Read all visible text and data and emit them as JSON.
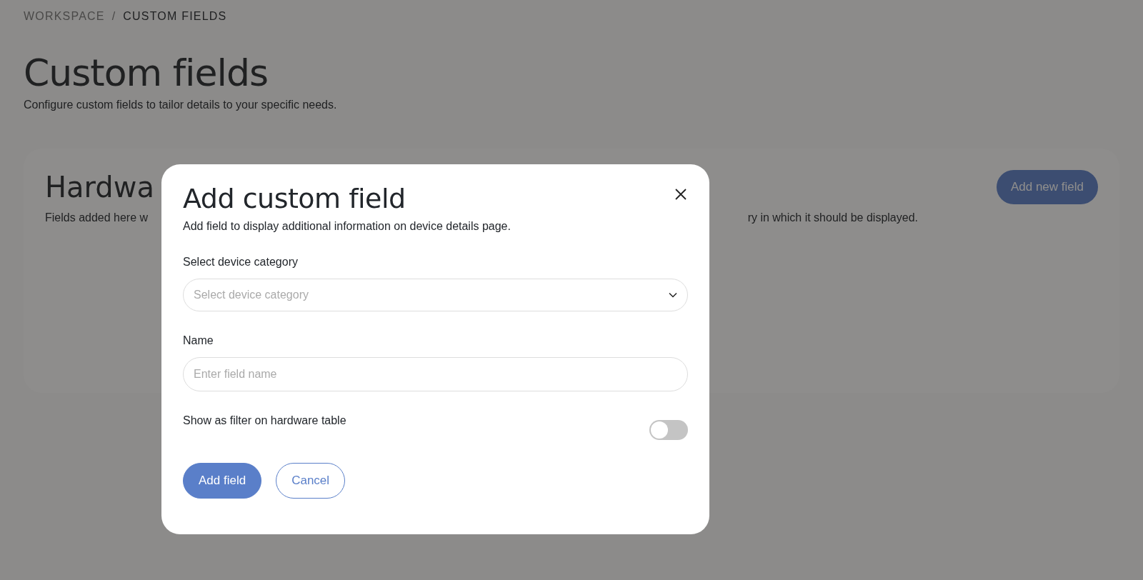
{
  "breadcrumb": [
    {
      "label": "WORKSPACE",
      "current": false
    },
    {
      "label": "CUSTOM FIELDS",
      "current": true
    }
  ],
  "breadcrumb_separator": "/",
  "page": {
    "title": "Custom fields",
    "subtitle": "Configure custom fields to tailor details to your specific needs."
  },
  "card": {
    "title": "Hardwa",
    "description_start": "Fields added here w",
    "description_end": "ry in which it should be displayed.",
    "button": "Add new field"
  },
  "dialog": {
    "title": "Add custom field",
    "subtitle": "Add field to display additional information on device details page.",
    "category": {
      "label": "Select device category",
      "placeholder": "Select device category"
    },
    "name": {
      "label": "Name",
      "placeholder": "Enter field name"
    },
    "filter_toggle": {
      "label": "Show as filter on hardware table",
      "on": false
    },
    "buttons": [
      {
        "label": "Add field",
        "kind": "primary"
      },
      {
        "label": "Cancel",
        "kind": "secondary"
      }
    ]
  }
}
